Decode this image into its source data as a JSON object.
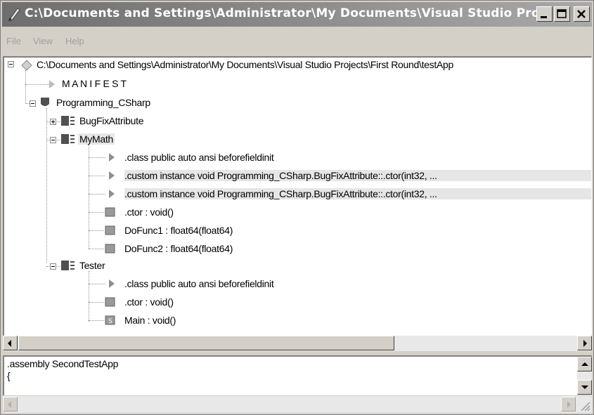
{
  "window": {
    "title": "C:\\Documents and Settings\\Administrator\\My Documents\\Visual Studio Pro...",
    "minimize_icon": "minimize-icon",
    "maximize_icon": "maximize-icon",
    "close_icon": "close-icon"
  },
  "menu": [
    "File",
    "View",
    "Help"
  ],
  "tree": {
    "root": "C:\\Documents and Settings\\Administrator\\My Documents\\Visual Studio Projects\\First Round\\testApp",
    "manifest": "M A N I F E S T",
    "namespace": "Programming_CSharp",
    "class_bugfix": "BugFixAttribute",
    "class_mymath": "MyMath",
    "mymath_items": [
      ".class public auto ansi beforefieldinit",
      ".custom instance void Programming_CSharp.BugFixAttribute::.ctor(int32, ...",
      ".custom instance void Programming_CSharp.BugFixAttribute::.ctor(int32, ...",
      ".ctor : void()",
      "DoFunc1 : float64(float64)",
      "DoFunc2 : float64(float64)"
    ],
    "class_tester": "Tester",
    "tester_items": [
      ".class public auto ansi beforefieldinit",
      ".ctor : void()",
      "Main : void()"
    ]
  },
  "text_pane": {
    "lines": [
      ".assembly SecondTestApp",
      "{"
    ]
  },
  "colors": {
    "titlebar": "#6e6e6e",
    "window": "#d4d0c8",
    "selection": "#e6e6e6"
  }
}
